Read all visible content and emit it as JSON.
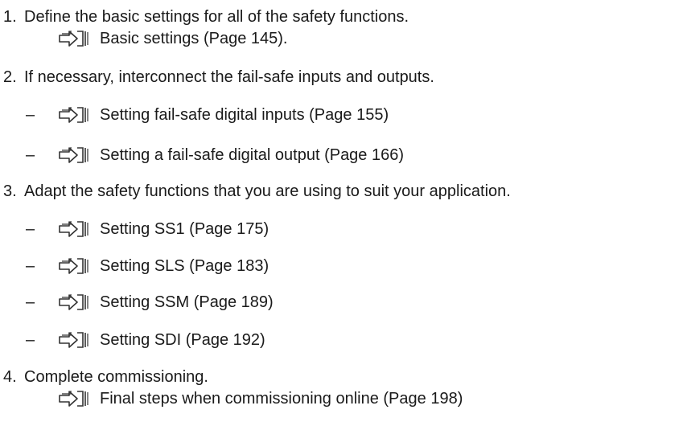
{
  "steps": [
    {
      "number": "1.",
      "text": "Define the basic settings for all of the safety functions.",
      "references": [
        {
          "dash": "",
          "icon": "page-reference-icon",
          "label": "Basic settings (Page 145)."
        }
      ]
    },
    {
      "number": "2.",
      "text": "If necessary, interconnect the fail-safe inputs and outputs.",
      "references": [
        {
          "dash": "–",
          "icon": "page-reference-icon",
          "label": "Setting fail-safe digital inputs (Page 155)"
        },
        {
          "dash": "–",
          "icon": "page-reference-icon",
          "label": "Setting a fail-safe digital output (Page 166)"
        }
      ]
    },
    {
      "number": "3.",
      "text": "Adapt the safety functions that you are using to suit your application.",
      "references": [
        {
          "dash": "–",
          "icon": "page-reference-icon",
          "label": "Setting SS1 (Page 175)"
        },
        {
          "dash": "–",
          "icon": "page-reference-icon",
          "label": "Setting SLS (Page 183)"
        },
        {
          "dash": "–",
          "icon": "page-reference-icon",
          "label": "Setting SSM (Page 189)"
        },
        {
          "dash": "–",
          "icon": "page-reference-icon",
          "label": "Setting SDI (Page 192)"
        }
      ]
    },
    {
      "number": "4.",
      "text": "Complete commissioning.",
      "references": [
        {
          "dash": "",
          "icon": "page-reference-icon",
          "label": "Final steps when commissioning online (Page 198)"
        }
      ]
    }
  ],
  "colors": {
    "text": "#1a1a1a",
    "icon_stroke": "#333333",
    "background": "#ffffff"
  }
}
